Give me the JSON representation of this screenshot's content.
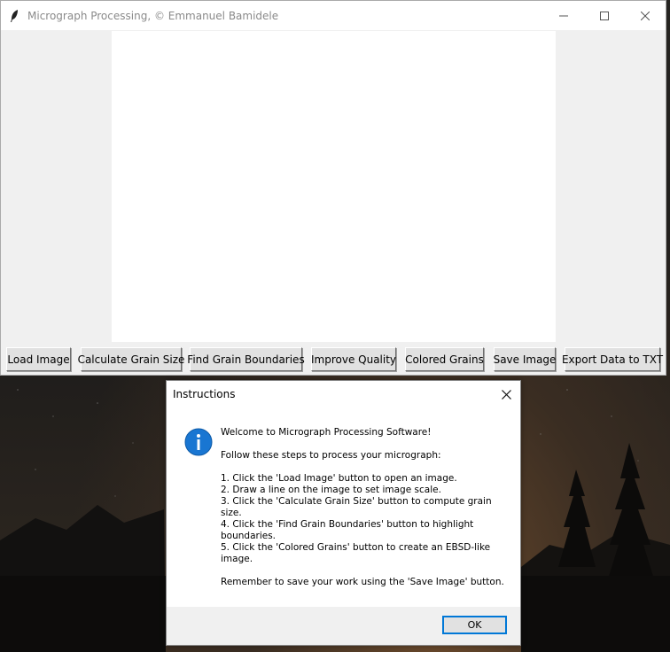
{
  "window": {
    "title": "Micrograph Processing,  © Emmanuel Bamidele",
    "icons": {
      "app": "feather-icon",
      "minimize": "minimize-icon",
      "maximize": "maximize-icon",
      "close": "close-icon"
    }
  },
  "toolbar": {
    "buttons": [
      {
        "label": "Load Image"
      },
      {
        "label": "Calculate Grain Size"
      },
      {
        "label": "Find Grain Boundaries"
      },
      {
        "label": "Improve Quality"
      },
      {
        "label": "Colored Grains"
      },
      {
        "label": "Save Image"
      },
      {
        "label": "Export Data to TXT"
      }
    ]
  },
  "dialog": {
    "title": "Instructions",
    "icon": "info-icon",
    "welcome": "Welcome to Micrograph Processing Software!",
    "intro": "Follow these steps to process your micrograph:",
    "steps": [
      "1. Click the 'Load Image' button to open an image.",
      "2. Draw a line on the image to set image scale.",
      "3. Click the 'Calculate Grain Size' button to compute grain size.",
      "4. Click the 'Find Grain Boundaries' button to highlight boundaries.",
      "5. Click the 'Colored Grains' button to create an EBSD-like image."
    ],
    "reminder": "Remember to save your work using the 'Save Image' button.",
    "ok_label": "OK"
  },
  "colors": {
    "window_bg": "#f0f0f0",
    "canvas_bg": "#ffffff",
    "accent": "#0078d7",
    "info_icon": "#1976d2"
  }
}
